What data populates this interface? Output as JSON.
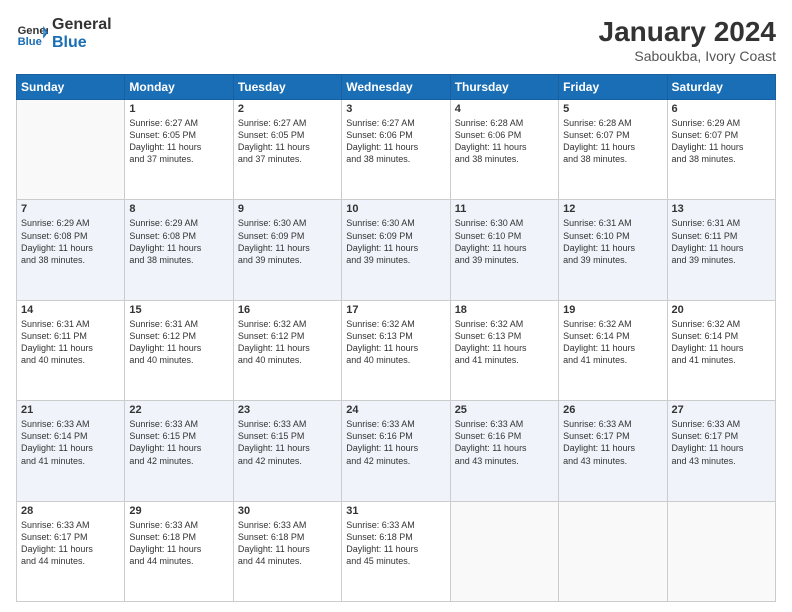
{
  "logo": {
    "line1": "General",
    "line2": "Blue"
  },
  "title": "January 2024",
  "subtitle": "Saboukba, Ivory Coast",
  "days_header": [
    "Sunday",
    "Monday",
    "Tuesday",
    "Wednesday",
    "Thursday",
    "Friday",
    "Saturday"
  ],
  "weeks": [
    [
      {
        "day": "",
        "info": ""
      },
      {
        "day": "1",
        "info": "Sunrise: 6:27 AM\nSunset: 6:05 PM\nDaylight: 11 hours\nand 37 minutes."
      },
      {
        "day": "2",
        "info": "Sunrise: 6:27 AM\nSunset: 6:05 PM\nDaylight: 11 hours\nand 37 minutes."
      },
      {
        "day": "3",
        "info": "Sunrise: 6:27 AM\nSunset: 6:06 PM\nDaylight: 11 hours\nand 38 minutes."
      },
      {
        "day": "4",
        "info": "Sunrise: 6:28 AM\nSunset: 6:06 PM\nDaylight: 11 hours\nand 38 minutes."
      },
      {
        "day": "5",
        "info": "Sunrise: 6:28 AM\nSunset: 6:07 PM\nDaylight: 11 hours\nand 38 minutes."
      },
      {
        "day": "6",
        "info": "Sunrise: 6:29 AM\nSunset: 6:07 PM\nDaylight: 11 hours\nand 38 minutes."
      }
    ],
    [
      {
        "day": "7",
        "info": "Sunrise: 6:29 AM\nSunset: 6:08 PM\nDaylight: 11 hours\nand 38 minutes."
      },
      {
        "day": "8",
        "info": "Sunrise: 6:29 AM\nSunset: 6:08 PM\nDaylight: 11 hours\nand 38 minutes."
      },
      {
        "day": "9",
        "info": "Sunrise: 6:30 AM\nSunset: 6:09 PM\nDaylight: 11 hours\nand 39 minutes."
      },
      {
        "day": "10",
        "info": "Sunrise: 6:30 AM\nSunset: 6:09 PM\nDaylight: 11 hours\nand 39 minutes."
      },
      {
        "day": "11",
        "info": "Sunrise: 6:30 AM\nSunset: 6:10 PM\nDaylight: 11 hours\nand 39 minutes."
      },
      {
        "day": "12",
        "info": "Sunrise: 6:31 AM\nSunset: 6:10 PM\nDaylight: 11 hours\nand 39 minutes."
      },
      {
        "day": "13",
        "info": "Sunrise: 6:31 AM\nSunset: 6:11 PM\nDaylight: 11 hours\nand 39 minutes."
      }
    ],
    [
      {
        "day": "14",
        "info": "Sunrise: 6:31 AM\nSunset: 6:11 PM\nDaylight: 11 hours\nand 40 minutes."
      },
      {
        "day": "15",
        "info": "Sunrise: 6:31 AM\nSunset: 6:12 PM\nDaylight: 11 hours\nand 40 minutes."
      },
      {
        "day": "16",
        "info": "Sunrise: 6:32 AM\nSunset: 6:12 PM\nDaylight: 11 hours\nand 40 minutes."
      },
      {
        "day": "17",
        "info": "Sunrise: 6:32 AM\nSunset: 6:13 PM\nDaylight: 11 hours\nand 40 minutes."
      },
      {
        "day": "18",
        "info": "Sunrise: 6:32 AM\nSunset: 6:13 PM\nDaylight: 11 hours\nand 41 minutes."
      },
      {
        "day": "19",
        "info": "Sunrise: 6:32 AM\nSunset: 6:14 PM\nDaylight: 11 hours\nand 41 minutes."
      },
      {
        "day": "20",
        "info": "Sunrise: 6:32 AM\nSunset: 6:14 PM\nDaylight: 11 hours\nand 41 minutes."
      }
    ],
    [
      {
        "day": "21",
        "info": "Sunrise: 6:33 AM\nSunset: 6:14 PM\nDaylight: 11 hours\nand 41 minutes."
      },
      {
        "day": "22",
        "info": "Sunrise: 6:33 AM\nSunset: 6:15 PM\nDaylight: 11 hours\nand 42 minutes."
      },
      {
        "day": "23",
        "info": "Sunrise: 6:33 AM\nSunset: 6:15 PM\nDaylight: 11 hours\nand 42 minutes."
      },
      {
        "day": "24",
        "info": "Sunrise: 6:33 AM\nSunset: 6:16 PM\nDaylight: 11 hours\nand 42 minutes."
      },
      {
        "day": "25",
        "info": "Sunrise: 6:33 AM\nSunset: 6:16 PM\nDaylight: 11 hours\nand 43 minutes."
      },
      {
        "day": "26",
        "info": "Sunrise: 6:33 AM\nSunset: 6:17 PM\nDaylight: 11 hours\nand 43 minutes."
      },
      {
        "day": "27",
        "info": "Sunrise: 6:33 AM\nSunset: 6:17 PM\nDaylight: 11 hours\nand 43 minutes."
      }
    ],
    [
      {
        "day": "28",
        "info": "Sunrise: 6:33 AM\nSunset: 6:17 PM\nDaylight: 11 hours\nand 44 minutes."
      },
      {
        "day": "29",
        "info": "Sunrise: 6:33 AM\nSunset: 6:18 PM\nDaylight: 11 hours\nand 44 minutes."
      },
      {
        "day": "30",
        "info": "Sunrise: 6:33 AM\nSunset: 6:18 PM\nDaylight: 11 hours\nand 44 minutes."
      },
      {
        "day": "31",
        "info": "Sunrise: 6:33 AM\nSunset: 6:18 PM\nDaylight: 11 hours\nand 45 minutes."
      },
      {
        "day": "",
        "info": ""
      },
      {
        "day": "",
        "info": ""
      },
      {
        "day": "",
        "info": ""
      }
    ]
  ]
}
